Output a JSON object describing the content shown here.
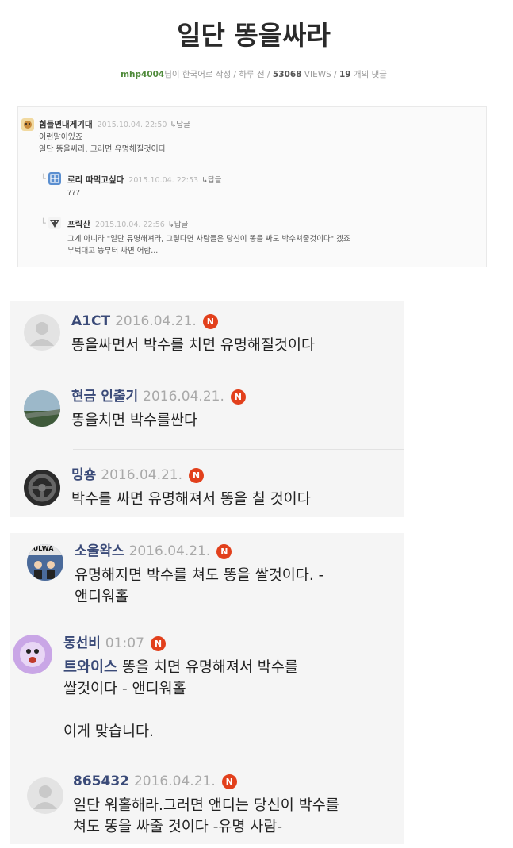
{
  "post": {
    "title": "일단 똥을싸라",
    "author": "mhp4004",
    "meta_suffix": "님이 한국어로 작성 / 하루 전 / ",
    "views": "53068",
    "views_label": " VIEWS / ",
    "comment_count": "19",
    "comment_label": " 개의 댓글"
  },
  "thread": [
    {
      "name": "힘들면내게기대",
      "date": "2015.10.04. 22:50",
      "reply": "↳답글",
      "lines": [
        "이런말이있죠",
        "일단 똥을싸라. 그러면 유명해질것이다"
      ],
      "avatar": "user-avatar-icon"
    },
    {
      "name": "로리 따먹고싶다",
      "date": "2015.10.04. 22:53",
      "reply": "↳답글",
      "lines": [
        "???"
      ],
      "avatar": "user-avatar-icon"
    },
    {
      "name": "프릭산",
      "date": "2015.10.04. 22:56",
      "reply": "↳답글",
      "lines": [
        "그게 아니라 \"일단 유명해져라, 그렇다면 사람들은 당신이 똥을 싸도 박수쳐줄것이다\" 겠죠",
        "무턱대고 똥부터 싸면 어람..."
      ],
      "avatar": "user-avatar-icon"
    }
  ],
  "comments_a": [
    {
      "name": "A1CT",
      "date": "2016.04.21.",
      "badge": "N",
      "text": "똥을싸면서 박수를 치면 유명해질것이다"
    },
    {
      "name": "현금 인출기",
      "date": "2016.04.21.",
      "badge": "N",
      "text": "똥을치면 박수를싼다"
    },
    {
      "name": "밍숑",
      "date": "2016.04.21.",
      "badge": "N",
      "text": "박수를 싸면 유명해져서 똥을 칠 것이다"
    }
  ],
  "comments_b": [
    {
      "name": "소울왁스",
      "date": "2016.04.21.",
      "badge": "N",
      "lines": [
        "유명해지면 박수를 쳐도 똥을 쌀것이다. -",
        "앤디워홀"
      ],
      "avatar_text": "SULWA"
    },
    {
      "name": "동선비",
      "date": "01:07",
      "badge": "N",
      "tag": "트와이스",
      "lines": [
        " 똥을 치면 유명해져서 박수를",
        "쌀것이다 - 앤디워홀"
      ],
      "extra": "이게 맞습니다."
    },
    {
      "name": "865432",
      "date": "2016.04.21.",
      "badge": "N",
      "lines": [
        "일단 워홀해라.그러면 앤디는 당신이 박수를",
        "쳐도 똥을 싸줄 것이다 -유명 사람-"
      ]
    }
  ],
  "colors": {
    "badge": "#e2401c",
    "name": "#3a4a78",
    "author": "#4f8a3a"
  }
}
